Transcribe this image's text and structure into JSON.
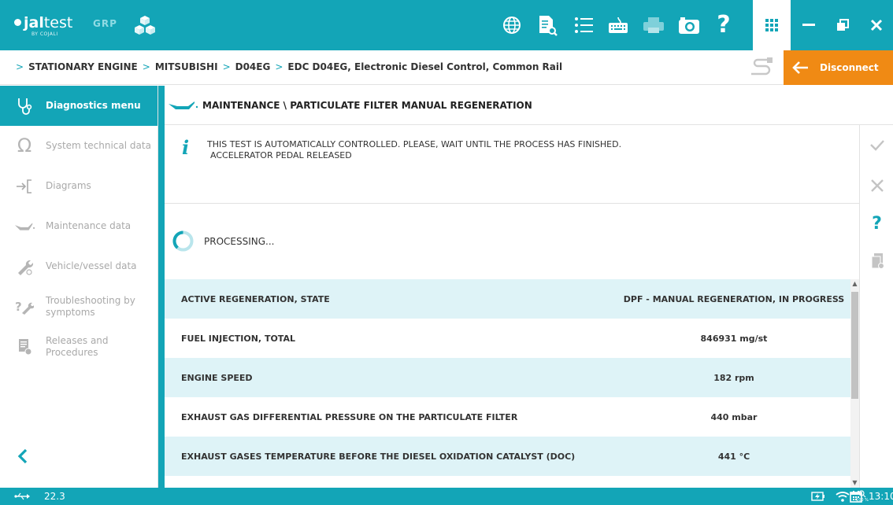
{
  "app": {
    "brand_bold": "jal",
    "brand_light": "test",
    "by": "BY COJALI",
    "grp": "GRP"
  },
  "breadcrumb": [
    "STATIONARY ENGINE",
    "MITSUBISHI",
    "D04EG",
    "EDC D04EG, Electronic Diesel Control, Common Rail"
  ],
  "disconnect_label": "Disconnect",
  "sidebar": {
    "items": [
      {
        "label": "Diagnostics menu",
        "icon": "stethoscope-icon",
        "active": true
      },
      {
        "label": "System technical data",
        "icon": "omega-icon",
        "active": false
      },
      {
        "label": "Diagrams",
        "icon": "diagram-icon",
        "active": false
      },
      {
        "label": "Maintenance data",
        "icon": "oil-can-icon",
        "active": false
      },
      {
        "label": "Vehicle/vessel data",
        "icon": "wrench-icon",
        "active": false
      },
      {
        "label": "Troubleshooting by symptoms",
        "icon": "troubleshoot-icon",
        "active": false
      },
      {
        "label": "Releases and Procedures",
        "icon": "releases-icon",
        "active": false
      }
    ]
  },
  "main": {
    "title": "MAINTENANCE \\ PARTICULATE FILTER MANUAL REGENERATION",
    "info_line1": "THIS TEST IS AUTOMATICALLY CONTROLLED. PLEASE, WAIT UNTIL THE PROCESS HAS FINISHED.",
    "info_line2": "ACCELERATOR PEDAL RELEASED",
    "processing": "PROCESSING...",
    "rows": [
      {
        "name": "ACTIVE REGENERATION, STATE",
        "value": "DPF - MANUAL REGENERATION, IN PROGRESS"
      },
      {
        "name": "FUEL INJECTION, TOTAL",
        "value": "846931 mg/st"
      },
      {
        "name": "ENGINE SPEED",
        "value": "182 rpm"
      },
      {
        "name": "EXHAUST GAS DIFFERENTIAL PRESSURE ON THE PARTICULATE FILTER",
        "value": "440 mbar"
      },
      {
        "name": "EXHAUST GASES TEMPERATURE BEFORE THE DIESEL OXIDATION CATALYST (DOC)",
        "value": "441 °C"
      }
    ]
  },
  "status": {
    "voltage": "22.3",
    "zoom": "100 %",
    "time": "13:10"
  },
  "colors": {
    "accent": "#13a5b7",
    "disconnect": "#f08a14",
    "row_alt": "#def3f7"
  }
}
